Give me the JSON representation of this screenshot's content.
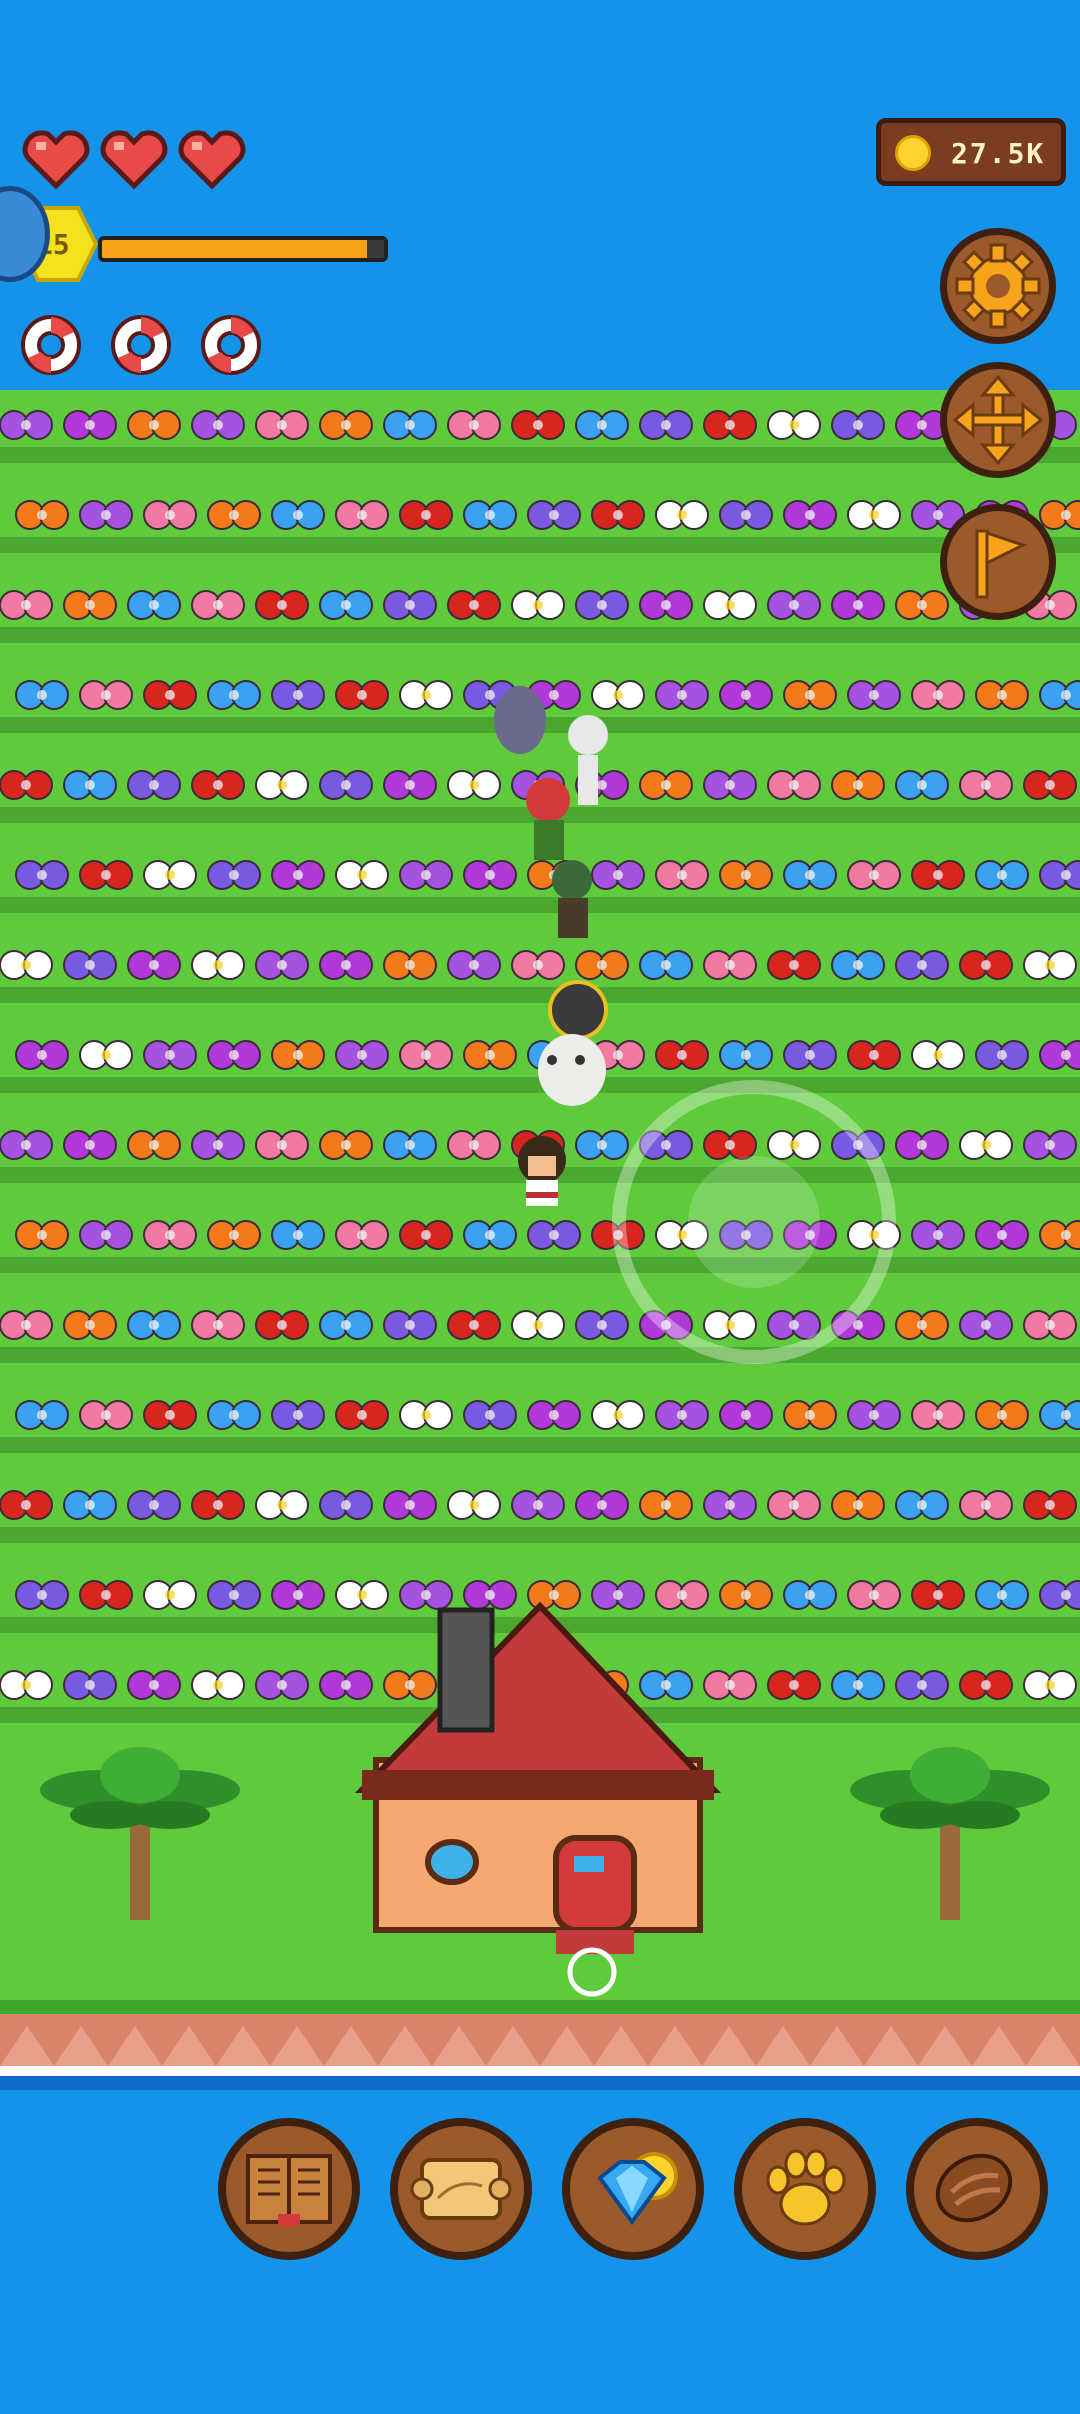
{
  "hud": {
    "hearts": 3,
    "lifebuoys": 3,
    "level": "15",
    "xp_progress": 0.94,
    "coins": "27.5K"
  },
  "side_buttons": [
    "gear-icon",
    "move-icon",
    "flag-icon"
  ],
  "bottom_buttons": [
    "book-icon",
    "map-scroll-icon",
    "gem-coin-icon",
    "paw-icon",
    "meat-icon"
  ],
  "colors": {
    "sky_water": "#1493ea",
    "grass": "#5fcb3c",
    "button_brown": "#9c5a2a",
    "xp_fill": "#f7a41c"
  }
}
